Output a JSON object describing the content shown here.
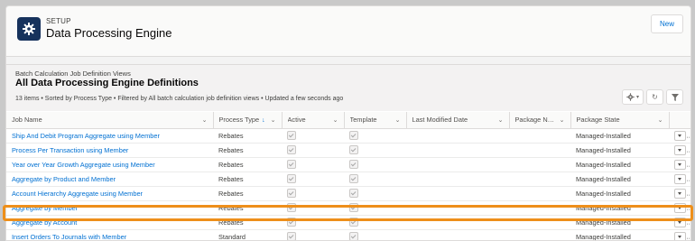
{
  "header": {
    "kicker": "SETUP",
    "title": "Data Processing Engine",
    "new_label": "New"
  },
  "list": {
    "kicker": "Batch Calculation Job Definition Views",
    "title": "All Data Processing Engine Definitions",
    "meta": "13 items • Sorted by Process Type • Filtered by All batch calculation job definition views • Updated a few seconds ago"
  },
  "columns": [
    "Job Name",
    "Process Type",
    "Active",
    "Template",
    "Last Modified Date",
    "Package Na...",
    "Package State"
  ],
  "rows": [
    {
      "name": "Ship And Debit Program Aggregate using Member",
      "type": "Rebates",
      "active": true,
      "template": true,
      "modified": "",
      "package": "",
      "state": "Managed-Installed"
    },
    {
      "name": "Process Per Transaction using Member",
      "type": "Rebates",
      "active": true,
      "template": true,
      "modified": "",
      "package": "",
      "state": "Managed-Installed"
    },
    {
      "name": "Year over Year Growth Aggregate using Member",
      "type": "Rebates",
      "active": true,
      "template": true,
      "modified": "",
      "package": "",
      "state": "Managed-Installed"
    },
    {
      "name": "Aggregate by Product and Member",
      "type": "Rebates",
      "active": true,
      "template": true,
      "modified": "",
      "package": "",
      "state": "Managed-Installed"
    },
    {
      "name": "Account Hierarchy Aggregate using Member",
      "type": "Rebates",
      "active": true,
      "template": true,
      "modified": "",
      "package": "",
      "state": "Managed-Installed"
    },
    {
      "name": "Aggregate by Member",
      "type": "Rebates",
      "active": true,
      "template": true,
      "modified": "",
      "package": "",
      "state": "Managed-Installed"
    },
    {
      "name": "Aggregate by Account",
      "type": "Rebates",
      "active": true,
      "template": true,
      "modified": "",
      "package": "",
      "state": "Managed-Installed"
    },
    {
      "name": "Insert Orders To Journals with Member",
      "type": "Standard",
      "active": true,
      "template": true,
      "modified": "",
      "package": "",
      "state": "Managed-Installed"
    }
  ],
  "highlight_color": "#ee8f1a",
  "icons": {
    "setup": "gear-icon",
    "settings": "gear-icon",
    "refresh": "refresh-icon",
    "filter": "filter-icon",
    "column_menu": "chevron-down-icon",
    "sort": "arrow-down-icon"
  }
}
